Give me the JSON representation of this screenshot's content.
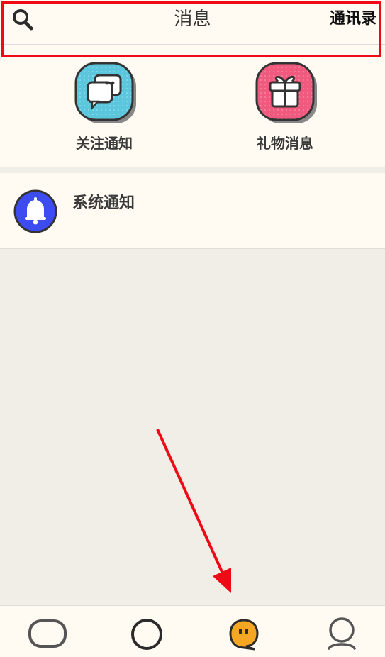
{
  "header": {
    "title": "消息",
    "contacts_label": "通讯录"
  },
  "quick_actions": [
    {
      "label": "关注通知",
      "icon": "chat-bubbles-icon",
      "color": "#5cc6dd"
    },
    {
      "label": "礼物消息",
      "icon": "gift-icon",
      "color": "#f05a7e"
    }
  ],
  "system_notice": {
    "label": "系统通知",
    "icon": "bell-icon",
    "color": "#3d4cf0"
  },
  "bottom_nav": [
    {
      "name": "home",
      "icon": "rounded-rect-icon",
      "active": false
    },
    {
      "name": "discover",
      "icon": "circle-icon",
      "active": false
    },
    {
      "name": "messages",
      "icon": "chat-face-icon",
      "active": true,
      "color": "#f5a623"
    },
    {
      "name": "profile",
      "icon": "person-icon",
      "active": false
    }
  ],
  "colors": {
    "background": "#f1eee8",
    "panel": "#fffbf3",
    "annotation_red": "#ee0b16"
  }
}
